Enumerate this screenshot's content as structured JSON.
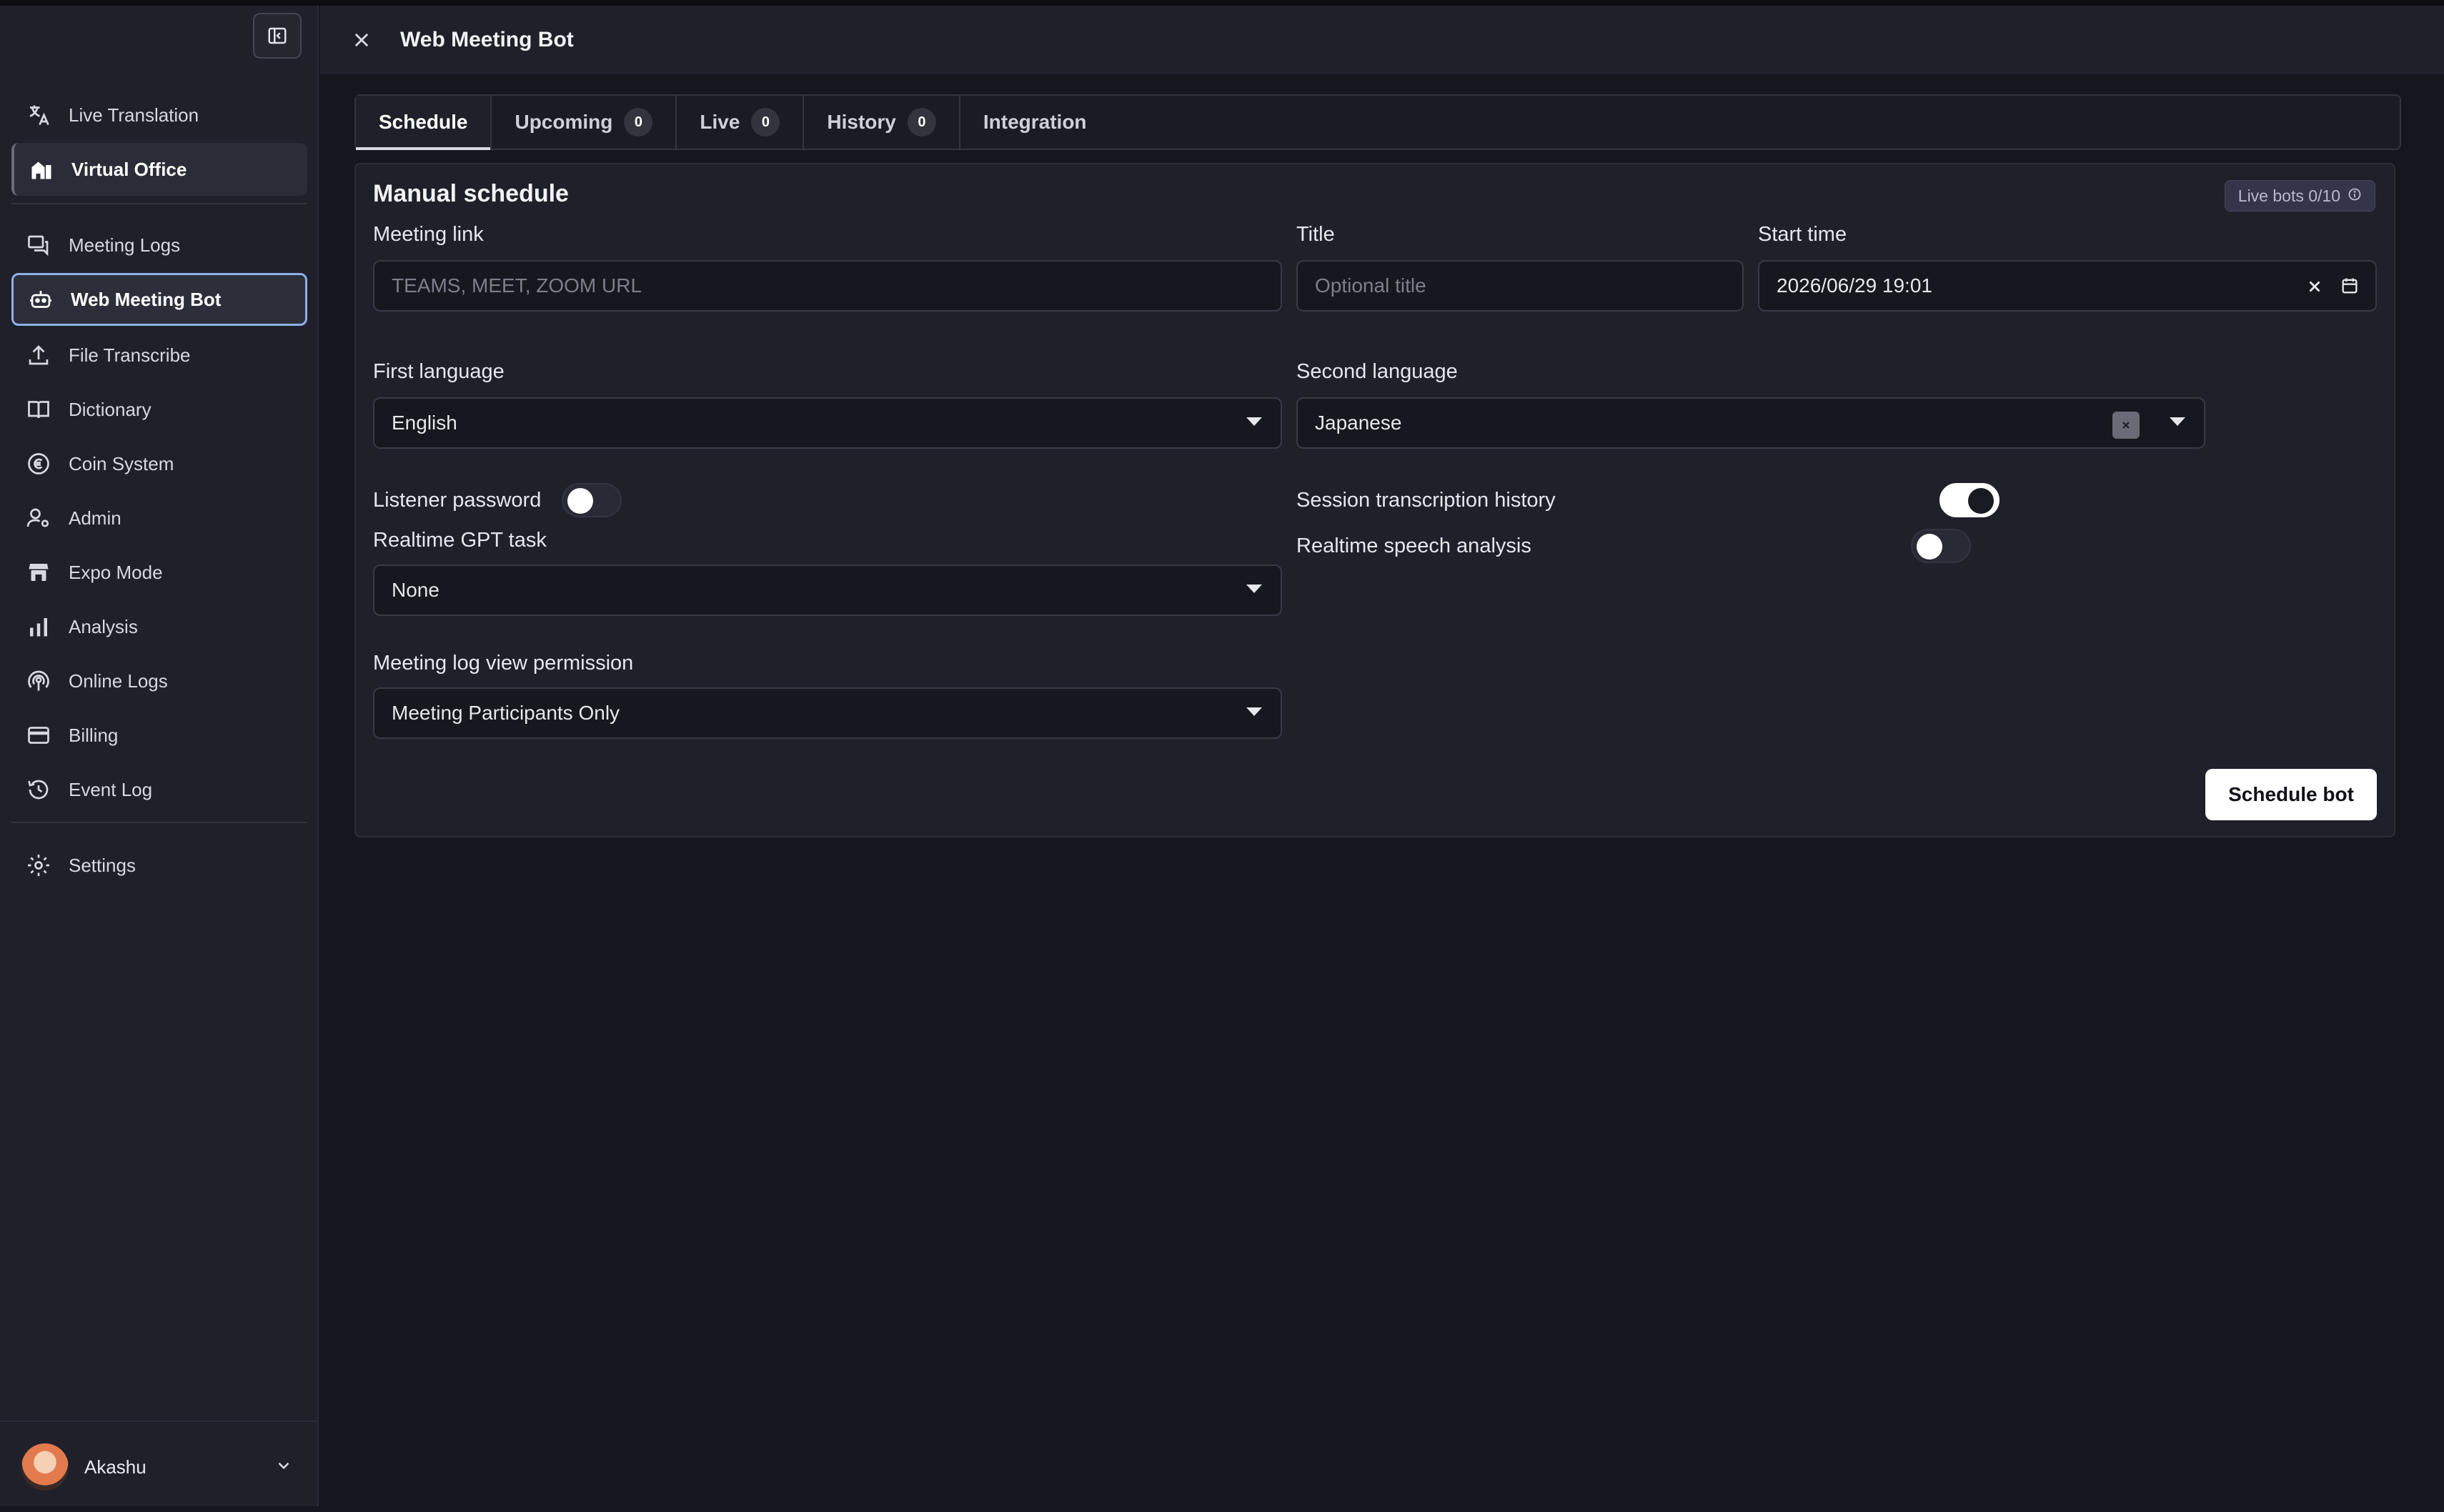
{
  "sidebar": {
    "items": [
      {
        "label": "Live Translation",
        "icon": "translate-icon"
      },
      {
        "label": "Virtual Office",
        "icon": "office-building-icon"
      },
      {
        "label": "Meeting Logs",
        "icon": "chat-bubbles-icon"
      },
      {
        "label": "Web Meeting Bot",
        "icon": "robot-icon"
      },
      {
        "label": "File Transcribe",
        "icon": "upload-icon"
      },
      {
        "label": "Dictionary",
        "icon": "book-icon"
      },
      {
        "label": "Coin System",
        "icon": "coin-icon"
      },
      {
        "label": "Admin",
        "icon": "admin-gear-user-icon"
      },
      {
        "label": "Expo Mode",
        "icon": "storefront-icon"
      },
      {
        "label": "Analysis",
        "icon": "bar-chart-icon"
      },
      {
        "label": "Online Logs",
        "icon": "broadcast-icon"
      },
      {
        "label": "Billing",
        "icon": "credit-card-icon"
      },
      {
        "label": "Event Log",
        "icon": "history-icon"
      },
      {
        "label": "Settings",
        "icon": "gear-icon"
      }
    ],
    "user": {
      "name": "Akashu"
    }
  },
  "header": {
    "title": "Web Meeting Bot"
  },
  "tabs": [
    {
      "label": "Schedule"
    },
    {
      "label": "Upcoming",
      "count": "0"
    },
    {
      "label": "Live",
      "count": "0"
    },
    {
      "label": "History",
      "count": "0"
    },
    {
      "label": "Integration"
    }
  ],
  "form": {
    "heading": "Manual schedule",
    "live_bots": "Live bots 0/10",
    "meeting_link": {
      "label": "Meeting link",
      "placeholder": "TEAMS, MEET, ZOOM URL"
    },
    "title": {
      "label": "Title",
      "placeholder": "Optional title"
    },
    "start_time": {
      "label": "Start time",
      "value": "2026/06/29 19:01"
    },
    "first_language": {
      "label": "First language",
      "value": "English"
    },
    "second_language": {
      "label": "Second language",
      "value": "Japanese"
    },
    "listener_password": {
      "label": "Listener password",
      "on": false
    },
    "session_history": {
      "label": "Session transcription history",
      "on": true
    },
    "speech_analysis": {
      "label": "Realtime speech analysis",
      "on": false
    },
    "gpt_task": {
      "label": "Realtime GPT task",
      "value": "None"
    },
    "log_permission": {
      "label": "Meeting log view permission",
      "value": "Meeting Participants Only"
    },
    "submit_label": "Schedule bot"
  },
  "colors": {
    "background": "#16161f",
    "panel": "#20202b",
    "active_border": "#8fb0e6",
    "button": "#ffffff"
  }
}
